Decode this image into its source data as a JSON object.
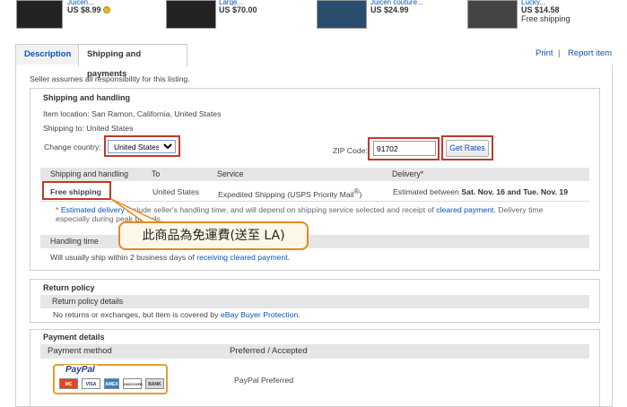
{
  "top_products": [
    {
      "name": "Juicen...",
      "price": "US $8.99",
      "sub": ""
    },
    {
      "name": "Large...",
      "price": "US $70.00",
      "sub": ""
    },
    {
      "name": "Juicen couture...",
      "price": "US $24.99",
      "sub": ""
    },
    {
      "name": "Lucky...",
      "price": "US $14.58",
      "sub": "Free shipping"
    }
  ],
  "tabs": [
    {
      "label": "Description"
    },
    {
      "label": "Shipping and payments"
    }
  ],
  "actions": {
    "print": "Print",
    "separator": "|",
    "report": "Report item"
  },
  "disclaimer": "Seller assumes all responsibility for this listing.",
  "shipping": {
    "title": "Shipping and handling",
    "item_location": "Item location: San Ramon, California, United States",
    "shipping_to": "Shipping to: United States",
    "change_country_label": "Change country:",
    "country_value": "United States",
    "zip_label": "ZIP Code:",
    "zip_value": "91702",
    "get_rates": "Get Rates",
    "columns": {
      "c1": "Shipping and handling",
      "c2": "To",
      "c3": "Service",
      "c4": "Delivery*"
    },
    "row": {
      "cost": "Free shipping",
      "to": "United States",
      "service": "Expedited Shipping (USPS Priority Mail",
      "reg": "®",
      "service_end": ")",
      "delivery_prefix": "Estimated between ",
      "delivery_dates": "Sat. Nov. 16 and Tue. Nov. 19"
    },
    "note_star": "*",
    "note_link": "Estimated delivery",
    "note_text": " include seller's handling time, and will depend on shipping service selected and receipt of ",
    "note_link2": "cleared payment",
    "note_text2": ". Delivery time     especially during peak periods.",
    "handling_title": "Handling time",
    "handling_text": "Will usually ship within 2 business days of ",
    "handling_link": "receiving cleared payment",
    "handling_end": "."
  },
  "callout": "此商品為免運費(送至 LA)",
  "returns": {
    "title": "Return policy",
    "header": "Return policy details",
    "text": "No returns or exchanges, but item is covered by ",
    "link": "eBay Buyer Protection",
    "end": "."
  },
  "payment": {
    "title": "Payment details",
    "col1": "Payment method",
    "col2": "Preferred / Accepted",
    "paypal_logo": "PayPal",
    "cards": [
      "MC",
      "VISA",
      "AMEX",
      "DISCOVER",
      "BANK"
    ],
    "preferred": "PayPal Preferred"
  },
  "colors": {
    "link": "#0654ba",
    "highlight_box": "#c0392b",
    "callout_border": "#e08a28"
  }
}
